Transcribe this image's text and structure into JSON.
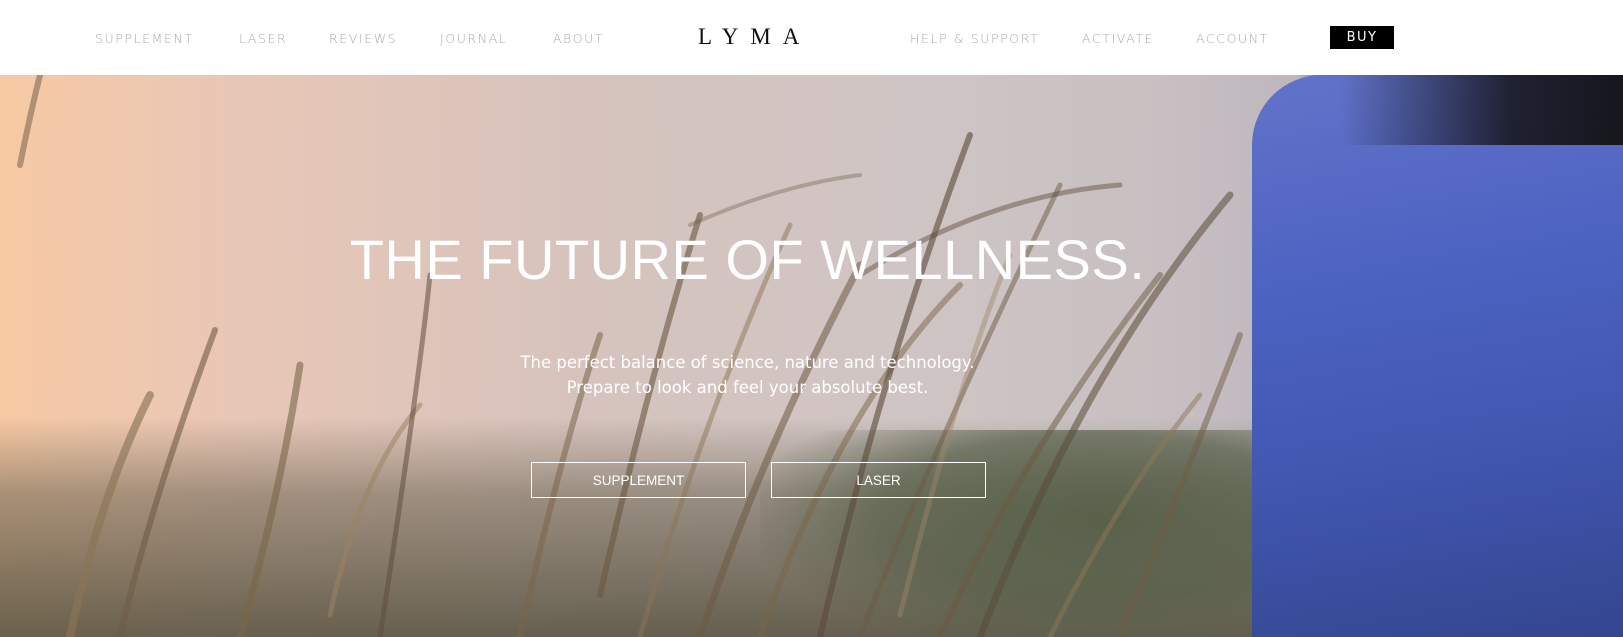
{
  "nav": {
    "left_links": [
      "SUPPLEMENT",
      "LASER",
      "REVIEWS",
      "JOURNAL",
      "ABOUT"
    ],
    "logo": "LYMA",
    "right_links": [
      "HELP & SUPPORT",
      "ACTIVATE",
      "ACCOUNT"
    ],
    "buy_label": "BUY"
  },
  "hero": {
    "title": "THE FUTURE OF WELLNESS.",
    "subtitle_line1": "The perfect balance of science, nature and technology.",
    "subtitle_line2": "Prepare to look and feel your absolute best.",
    "button_supplement": "SUPPLEMENT",
    "button_laser": "LASER"
  },
  "colors": {
    "nav_text": "#a9a9a9",
    "buy_bg": "#000000",
    "hero_text": "#ffffff",
    "figure_blue": "#4d63c2"
  }
}
